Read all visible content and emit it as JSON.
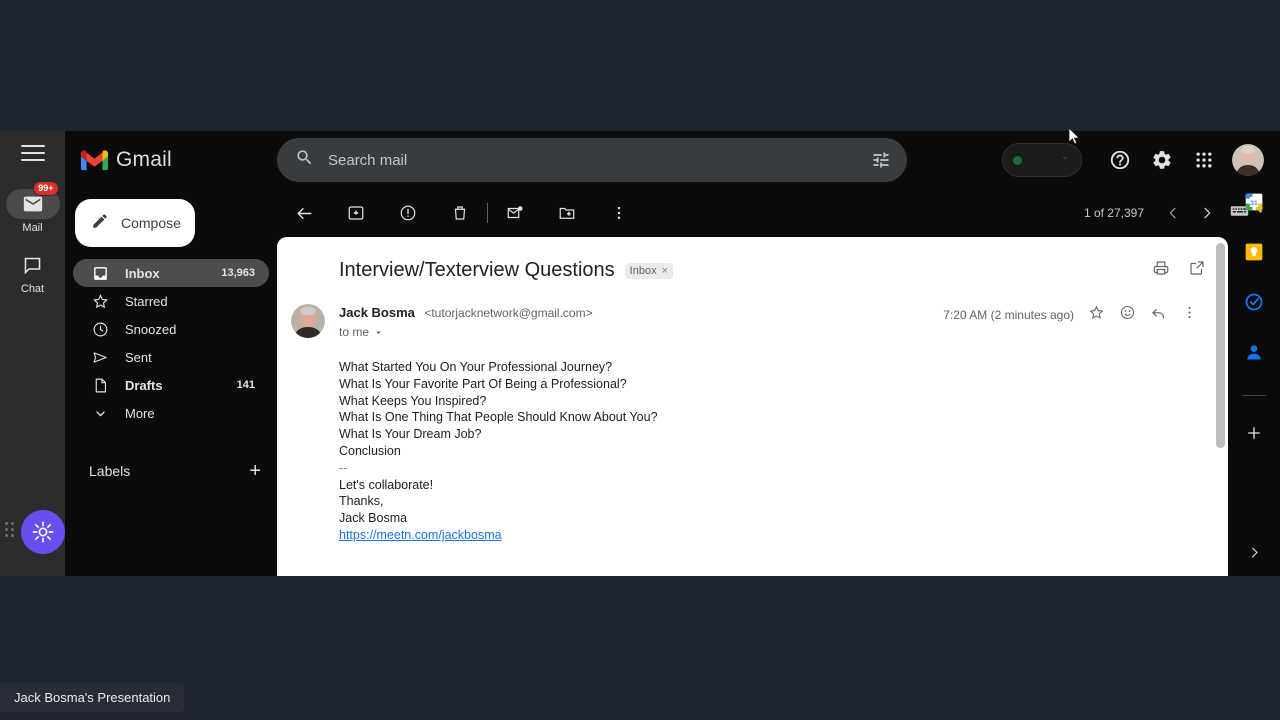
{
  "app": {
    "brand": "Gmail",
    "logo_icon": "gmail-m-logo"
  },
  "rail": {
    "menu_icon": "hamburger-menu-icon",
    "items": [
      {
        "label": "Mail",
        "icon": "mail-envelope-icon",
        "badge": "99+",
        "active": true
      },
      {
        "label": "Chat",
        "icon": "chat-bubble-icon",
        "badge": "",
        "active": false
      }
    ],
    "widget_icon": "sun-burst-icon",
    "widget_color": "#6b4ef0",
    "drag_handle_icon": "drag-dots-icon"
  },
  "search": {
    "placeholder": "Search mail",
    "icon": "search-icon",
    "options_icon": "search-options-icon"
  },
  "header": {
    "status_pill": {
      "dot_color": "#1e6b3a",
      "chevron_icon": "chevron-down-icon"
    },
    "help_icon": "help-circle-icon",
    "settings_icon": "gear-icon",
    "apps_icon": "apps-grid-icon",
    "avatar_icon": "user-avatar"
  },
  "sidebar": {
    "compose": {
      "label": "Compose",
      "icon": "pencil-compose-icon"
    },
    "items": [
      {
        "label": "Inbox",
        "icon": "inbox-icon",
        "count": "13,963",
        "selected": true,
        "bold": true
      },
      {
        "label": "Starred",
        "icon": "star-icon",
        "count": "",
        "selected": false,
        "bold": false
      },
      {
        "label": "Snoozed",
        "icon": "clock-icon",
        "count": "",
        "selected": false,
        "bold": false
      },
      {
        "label": "Sent",
        "icon": "send-icon",
        "count": "",
        "selected": false,
        "bold": false
      },
      {
        "label": "Drafts",
        "icon": "draft-file-icon",
        "count": "141",
        "selected": false,
        "bold": true
      },
      {
        "label": "More",
        "icon": "chevron-down-icon",
        "count": "",
        "selected": false,
        "bold": false
      }
    ],
    "labels_title": "Labels",
    "labels_add_icon": "plus-icon"
  },
  "toolbar": {
    "back_icon": "back-arrow-icon",
    "archive_icon": "archive-icon",
    "spam_icon": "report-spam-icon",
    "delete_icon": "trash-icon",
    "unread_icon": "mark-unread-icon",
    "move_icon": "move-to-folder-icon",
    "more_icon": "more-vertical-icon",
    "pager_text": "1 of 27,397",
    "prev_icon": "chevron-left-icon",
    "next_icon": "chevron-right-icon",
    "input_tools_icon": "keyboard-icon",
    "input_tools_chevron_icon": "chevron-down-icon"
  },
  "email": {
    "subject": "Interview/Texterview Questions",
    "label_chip": "Inbox",
    "label_chip_remove": "×",
    "print_icon": "print-icon",
    "open_new_window_icon": "open-in-new-icon",
    "sender_name": "Jack Bosma",
    "sender_email": "<tutorjacknetwork@gmail.com>",
    "recipient": "to me",
    "recipient_chevron_icon": "chevron-down-icon",
    "timestamp": "7:20 AM (2 minutes ago)",
    "star_icon": "star-outline-icon",
    "react_icon": "emoji-react-icon",
    "reply_icon": "reply-arrow-icon",
    "more_icon": "more-vertical-icon",
    "body_lines": [
      "What Started You On Your Professional Journey?",
      "What Is Your Favorite Part Of Being a Professional?",
      "What Keeps You Inspired?",
      "What Is One Thing That People Should Know About You?",
      "What Is Your Dream Job?",
      "Conclusion"
    ],
    "signature_dashes": "--",
    "signature_lines": [
      "Let's collaborate!",
      "Thanks,",
      "Jack Bosma"
    ],
    "signature_link": "https://meetn.com/jackbosma"
  },
  "side_panel": {
    "items": [
      {
        "name": "google-calendar-icon",
        "label": "Calendar",
        "date": "31"
      },
      {
        "name": "google-keep-icon",
        "label": "Keep"
      },
      {
        "name": "google-tasks-icon",
        "label": "Tasks"
      },
      {
        "name": "google-contacts-icon",
        "label": "Contacts"
      }
    ],
    "add_on_icon": "plus-icon",
    "expand_icon": "chevron-right-icon"
  },
  "overlay": {
    "share_caption": "Jack Bosma's Presentation"
  }
}
